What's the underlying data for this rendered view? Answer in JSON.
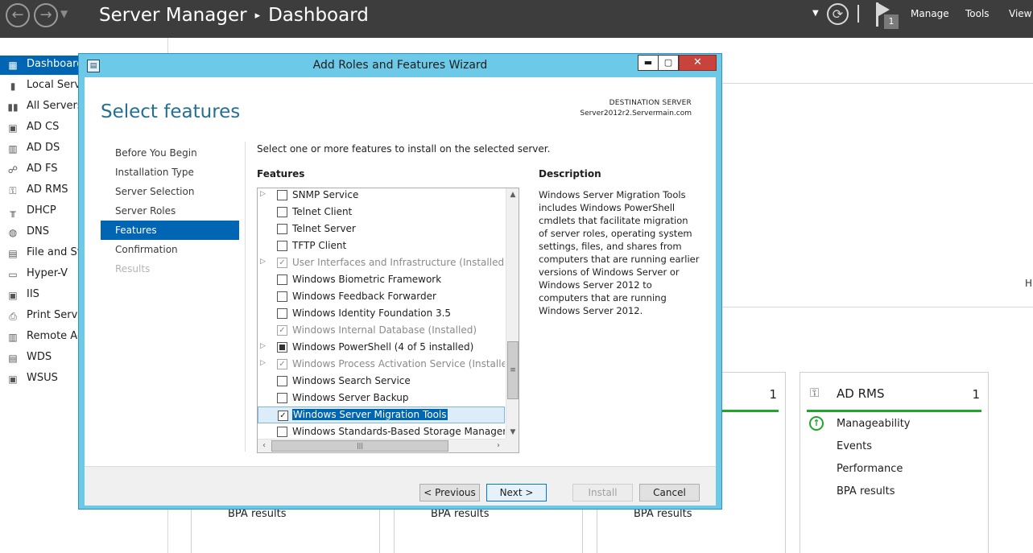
{
  "app": {
    "title": "Server Manager",
    "breadcrumb_sep": "▸",
    "page": "Dashboard",
    "notification_count": "1",
    "menus": [
      "Manage",
      "Tools",
      "View"
    ]
  },
  "sidebar": {
    "items": [
      {
        "label": "Dashboard",
        "icon": "dashboard-icon"
      },
      {
        "label": "Local Server",
        "icon": "local-server-icon"
      },
      {
        "label": "All Servers",
        "icon": "all-servers-icon"
      },
      {
        "label": "AD CS",
        "icon": "adcs-icon"
      },
      {
        "label": "AD DS",
        "icon": "adds-icon"
      },
      {
        "label": "AD FS",
        "icon": "adfs-icon"
      },
      {
        "label": "AD RMS",
        "icon": "adrms-icon"
      },
      {
        "label": "DHCP",
        "icon": "dhcp-icon"
      },
      {
        "label": "DNS",
        "icon": "dns-icon"
      },
      {
        "label": "File and Storage Services",
        "icon": "file-storage-icon"
      },
      {
        "label": "Hyper-V",
        "icon": "hyperv-icon"
      },
      {
        "label": "IIS",
        "icon": "iis-icon"
      },
      {
        "label": "Print Services",
        "icon": "print-icon"
      },
      {
        "label": "Remote Access",
        "icon": "remote-access-icon"
      },
      {
        "label": "WDS",
        "icon": "wds-icon"
      },
      {
        "label": "WSUS",
        "icon": "wsus-icon"
      }
    ]
  },
  "main": {
    "side_letter": "H",
    "tiles": [
      {
        "name": "",
        "count": "",
        "bpa": "BPA results"
      },
      {
        "name": "",
        "count": "",
        "bpa": "BPA results"
      },
      {
        "name": "",
        "count": "1",
        "bpa": "BPA results"
      },
      {
        "name": "AD RMS",
        "count": "1",
        "rows": [
          "Manageability",
          "Events",
          "Performance",
          "BPA results"
        ]
      }
    ]
  },
  "wizard": {
    "title": "Add Roles and Features Wizard",
    "window_buttons": {
      "minimize": "▬",
      "maximize": "▢",
      "close": "✕"
    },
    "heading": "Select features",
    "destination_label": "DESTINATION SERVER",
    "destination_value": "Server2012r2.Servermain.com",
    "steps": [
      {
        "label": "Before You Begin",
        "state": "normal"
      },
      {
        "label": "Installation Type",
        "state": "normal"
      },
      {
        "label": "Server Selection",
        "state": "normal"
      },
      {
        "label": "Server Roles",
        "state": "normal"
      },
      {
        "label": "Features",
        "state": "active"
      },
      {
        "label": "Confirmation",
        "state": "normal"
      },
      {
        "label": "Results",
        "state": "disabled"
      }
    ],
    "instruction": "Select one or more features to install on the selected server.",
    "features_label": "Features",
    "description_label": "Description",
    "description_text": "Windows Server Migration Tools includes Windows PowerShell cmdlets that facilitate migration of server roles, operating system settings, files, and shares from computers that are running earlier versions of Windows Server or Windows Server 2012 to computers that are running Windows Server 2012.",
    "features": [
      {
        "label": "SNMP Service",
        "expandable": true,
        "state": "unchecked"
      },
      {
        "label": "Telnet Client",
        "expandable": false,
        "state": "unchecked"
      },
      {
        "label": "Telnet Server",
        "expandable": false,
        "state": "unchecked"
      },
      {
        "label": "TFTP Client",
        "expandable": false,
        "state": "unchecked"
      },
      {
        "label": "User Interfaces and Infrastructure (Installed)",
        "expandable": true,
        "state": "installed"
      },
      {
        "label": "Windows Biometric Framework",
        "expandable": false,
        "state": "unchecked"
      },
      {
        "label": "Windows Feedback Forwarder",
        "expandable": false,
        "state": "unchecked"
      },
      {
        "label": "Windows Identity Foundation 3.5",
        "expandable": false,
        "state": "unchecked"
      },
      {
        "label": "Windows Internal Database (Installed)",
        "expandable": false,
        "state": "installed"
      },
      {
        "label": "Windows PowerShell (4 of 5 installed)",
        "expandable": true,
        "state": "partial"
      },
      {
        "label": "Windows Process Activation Service (Installed)",
        "expandable": true,
        "state": "installed"
      },
      {
        "label": "Windows Search Service",
        "expandable": false,
        "state": "unchecked"
      },
      {
        "label": "Windows Server Backup",
        "expandable": false,
        "state": "unchecked"
      },
      {
        "label": "Windows Server Migration Tools",
        "expandable": false,
        "state": "checked",
        "selected": true
      },
      {
        "label": "Windows Standards-Based Storage Management",
        "expandable": false,
        "state": "unchecked"
      }
    ],
    "buttons": {
      "previous": "< Previous",
      "next": "Next >",
      "install": "Install",
      "cancel": "Cancel"
    }
  }
}
